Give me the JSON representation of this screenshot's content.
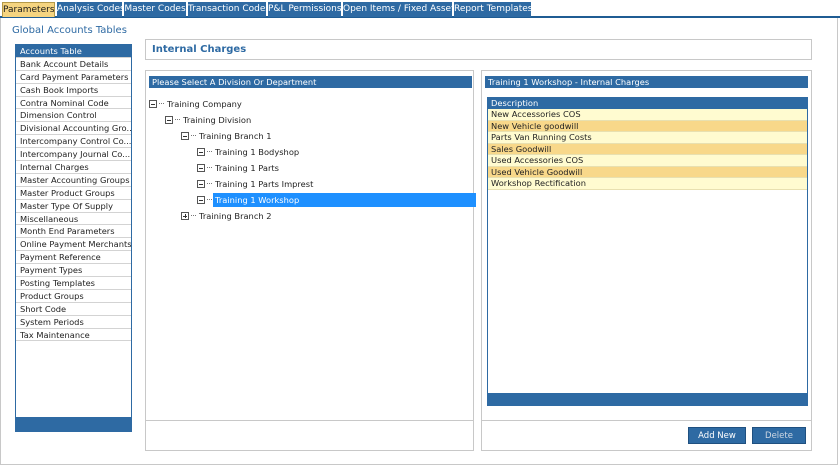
{
  "tabs": [
    {
      "label": "Parameters",
      "active": true
    },
    {
      "label": "Analysis Codes",
      "active": false
    },
    {
      "label": "Master Codes",
      "active": false
    },
    {
      "label": "Transaction Codes",
      "active": false
    },
    {
      "label": "P&L Permissions",
      "active": false
    },
    {
      "label": "Open Items / Fixed Assets",
      "active": false
    },
    {
      "label": "Report Templates",
      "active": false
    }
  ],
  "section_title": "Global Accounts Tables",
  "accounts_list": {
    "items": [
      "Accounts Table",
      "Bank Account Details",
      "Card Payment Parameters",
      "Cash Book Imports",
      "Contra Nominal Code",
      "Dimension Control",
      "Divisional Accounting Gro...",
      "Intercompany Control Co...",
      "Intercompany Journal Co...",
      "Internal Charges",
      "Master Accounting Groups",
      "Master Product Groups",
      "Master Type Of Supply",
      "Miscellaneous",
      "Month End Parameters",
      "Online Payment Merchants",
      "Payment Reference",
      "Payment Types",
      "Posting Templates",
      "Product Groups",
      "Short Code",
      "System Periods",
      "Tax Maintenance"
    ],
    "selected_index": 0
  },
  "main": {
    "title": "Internal Charges",
    "tree_panel": {
      "header": "Please Select A Division Or Department",
      "nodes": [
        {
          "label": "Training Company",
          "level": 0,
          "expander": "minus",
          "selected": false
        },
        {
          "label": "Training Division",
          "level": 1,
          "expander": "minus",
          "selected": false
        },
        {
          "label": "Training Branch 1",
          "level": 2,
          "expander": "minus",
          "selected": false
        },
        {
          "label": "Training 1 Bodyshop",
          "level": 3,
          "expander": "minus",
          "selected": false
        },
        {
          "label": "Training 1 Parts",
          "level": 3,
          "expander": "minus",
          "selected": false
        },
        {
          "label": "Training 1 Parts Imprest",
          "level": 3,
          "expander": "minus",
          "selected": false
        },
        {
          "label": "Training 1 Workshop",
          "level": 3,
          "expander": "minus",
          "selected": true
        },
        {
          "label": "Training Branch 2",
          "level": 2,
          "expander": "plus",
          "selected": false
        }
      ]
    },
    "charges_panel": {
      "header": "Training 1 Workshop - Internal Charges",
      "column_header": "Description",
      "rows": [
        "New Accessories COS",
        "New Vehicle goodwill",
        "Parts Van Running Costs",
        "Sales Goodwill",
        "Used Accessories COS",
        "Used Vehicle Goodwill",
        "Workshop Rectification"
      ],
      "add_label": "Add New",
      "delete_label": "Delete"
    }
  },
  "colors": {
    "accent": "#2e6aa3",
    "active_tab": "#f5d480",
    "row_light": "#fffbd0",
    "row_dark": "#f8d88a",
    "tree_selection": "#1e90ff"
  }
}
